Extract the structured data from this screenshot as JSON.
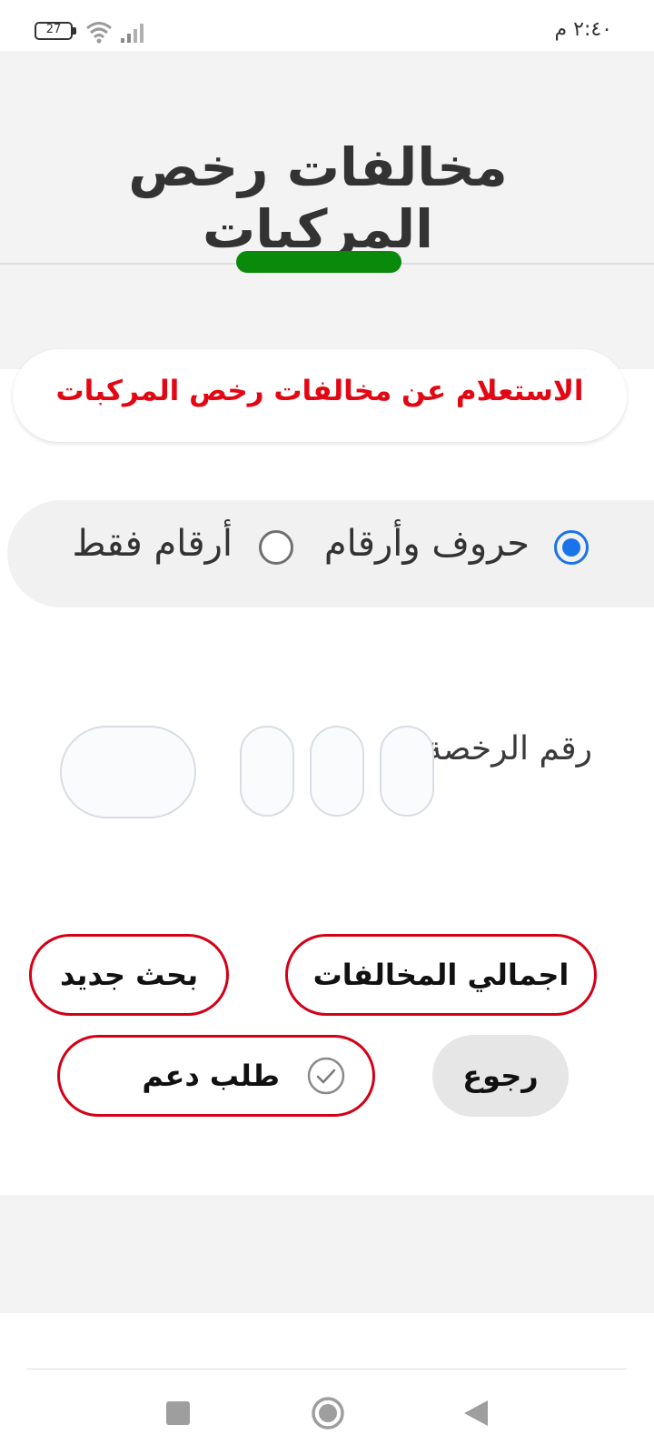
{
  "status_bar": {
    "time": "٢:٤٠ م",
    "battery": "27"
  },
  "header": {
    "title": "مخالفات رخص المركبات"
  },
  "inquiry": {
    "label": "الاستعلام عن مخالفات رخص المركبات"
  },
  "plate_type": {
    "options": [
      {
        "label": "حروف وأرقام",
        "selected": true
      },
      {
        "label": "أرقام فقط",
        "selected": false
      }
    ]
  },
  "license": {
    "label": "رقم الرخصة",
    "inputs": [
      "",
      "",
      "",
      ""
    ]
  },
  "buttons": {
    "total_violations": "اجمالي المخالفات",
    "new_search": "بحث جديد",
    "support_request": "طلب دعم",
    "back": "رجوع"
  },
  "colors": {
    "accent_green": "#0a8a0a",
    "accent_red": "#e30613",
    "radio_blue": "#1a73e8"
  },
  "icons": {
    "support": "check-circle-icon",
    "nav": [
      "recents-square-icon",
      "home-circle-icon",
      "back-triangle-icon"
    ]
  }
}
